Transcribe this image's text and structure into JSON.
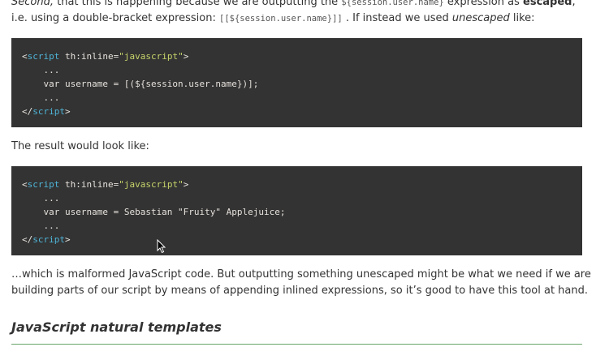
{
  "intro": {
    "l1_second": "Second,",
    "l1_text": " that this is happening because we are outputting the ",
    "l1_code": "${session.user.name}",
    "l1_text2": " expression as ",
    "l1_bold": "escaped",
    "l1_end": ",",
    "l2_text": "i.e. using a double-bracket expression: ",
    "l2_code": "[[${session.user.name}]]",
    "l2_text2": " . If instead we used ",
    "l2_italic": "unescaped",
    "l2_end": " like:"
  },
  "code1": {
    "open_lt": "<",
    "open_tag": "script",
    "attr": " th:inline",
    "eq": "=",
    "val": "\"javascript\"",
    "open_gt": ">",
    "dots1": "    ...",
    "line": "    var username = [(${session.user.name})];",
    "dots2": "    ...",
    "close_lt": "</",
    "close_tag": "script",
    "close_gt": ">"
  },
  "result_text": "The result would look like:",
  "code2": {
    "open_lt": "<",
    "open_tag": "script",
    "attr": " th:inline",
    "eq": "=",
    "val": "\"javascript\"",
    "open_gt": ">",
    "dots1": "    ...",
    "line": "    var username = Sebastian \"Fruity\" Applejuice;",
    "dots2": "    ...",
    "close_lt": "</",
    "close_tag": "script",
    "close_gt": ">"
  },
  "outro": {
    "l1": "…which is malformed JavaScript code. But outputting something unescaped might be what we need if we are",
    "l2": "building parts of our script by means of appending inlined expressions, so it’s good to have this tool at hand."
  },
  "heading": "JavaScript natural templates",
  "colors": {
    "code_bg": "#333333",
    "tag": "#4fb4d7",
    "string": "#c8d46a",
    "rule": "#6aa56a"
  },
  "icons": {
    "cursor": "mouse-pointer-icon"
  }
}
